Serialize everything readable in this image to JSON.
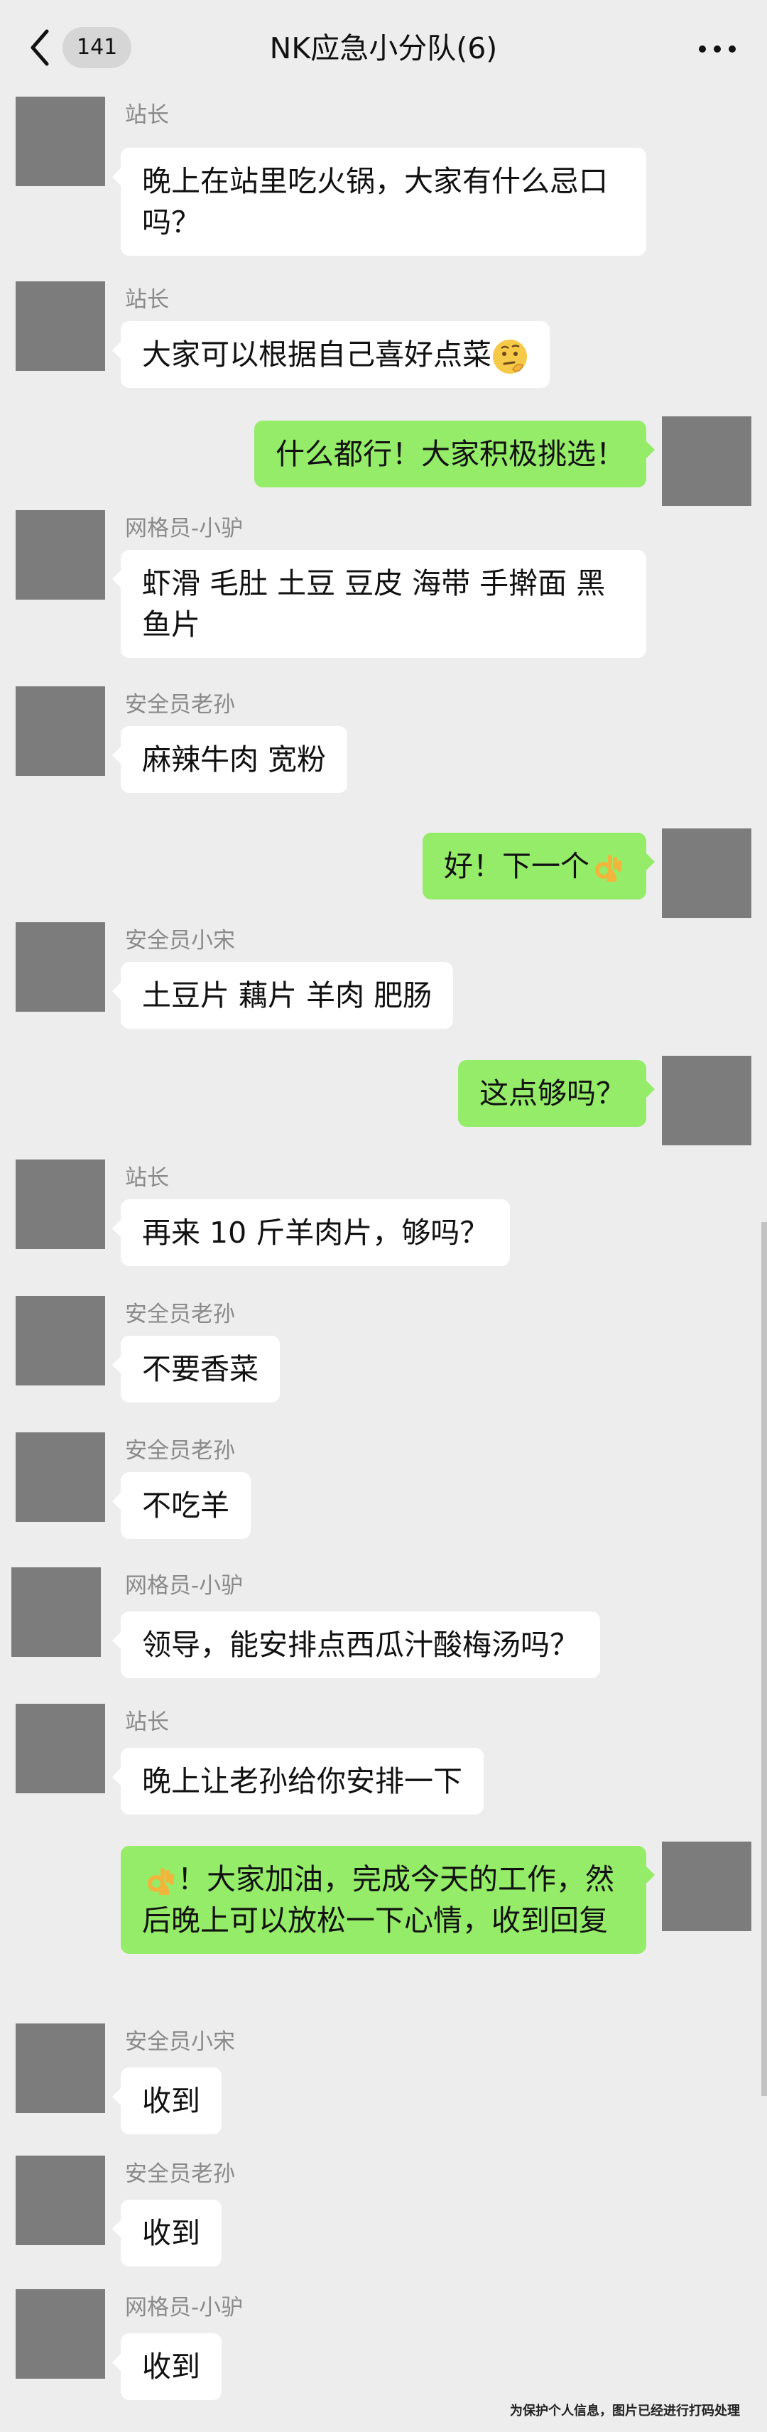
{
  "header": {
    "back_count": "141",
    "title": "NK应急小分队(6)"
  },
  "messages": [
    {
      "side": "in",
      "sender": "站长",
      "text": "晚上在站里吃火锅，大家有什么忌口吗？"
    },
    {
      "side": "in",
      "sender": "站长",
      "text": "大家可以根据自己喜好点菜",
      "emoji": "thinking-face"
    },
    {
      "side": "out",
      "text": "什么都行！大家积极挑选！"
    },
    {
      "side": "in",
      "sender": "网格员-小驴",
      "text": "虾滑 毛肚 土豆 豆皮 海带 手擀面 黑鱼片"
    },
    {
      "side": "in",
      "sender": "安全员老孙",
      "text": "麻辣牛肉  宽粉"
    },
    {
      "side": "out",
      "text": "好！下一个",
      "emoji": "ok-hand"
    },
    {
      "side": "in",
      "sender": "安全员小宋",
      "text": "土豆片 藕片 羊肉 肥肠"
    },
    {
      "side": "out",
      "text": "这点够吗？"
    },
    {
      "side": "in",
      "sender": "站长",
      "text": "再来 10 斤羊肉片，够吗？"
    },
    {
      "side": "in",
      "sender": "安全员老孙",
      "text": "不要香菜"
    },
    {
      "side": "in",
      "sender": "安全员老孙",
      "text": "不吃羊"
    },
    {
      "side": "in",
      "sender": "网格员-小驴",
      "text": "领导，能安排点西瓜汁酸梅汤吗？"
    },
    {
      "side": "in",
      "sender": "站长",
      "text": "晚上让老孙给你安排一下"
    },
    {
      "side": "out",
      "emoji_lead": "ok-hand",
      "text": "！大家加油，完成今天的工作，然后晚上可以放松一下心情，收到回复"
    },
    {
      "side": "in",
      "sender": "安全员小宋",
      "text": "收到"
    },
    {
      "side": "in",
      "sender": "安全员老孙",
      "text": "收到"
    },
    {
      "side": "in",
      "sender": "网格员-小驴",
      "text": "收到"
    }
  ],
  "footer_note": "为保护个人信息，图片已经进行打码处理",
  "colors": {
    "background": "#ededed",
    "incoming_bubble": "#ffffff",
    "outgoing_bubble": "#95ec69",
    "avatar_placeholder": "#7c7c7c",
    "sender_name": "#8a8a8a"
  }
}
